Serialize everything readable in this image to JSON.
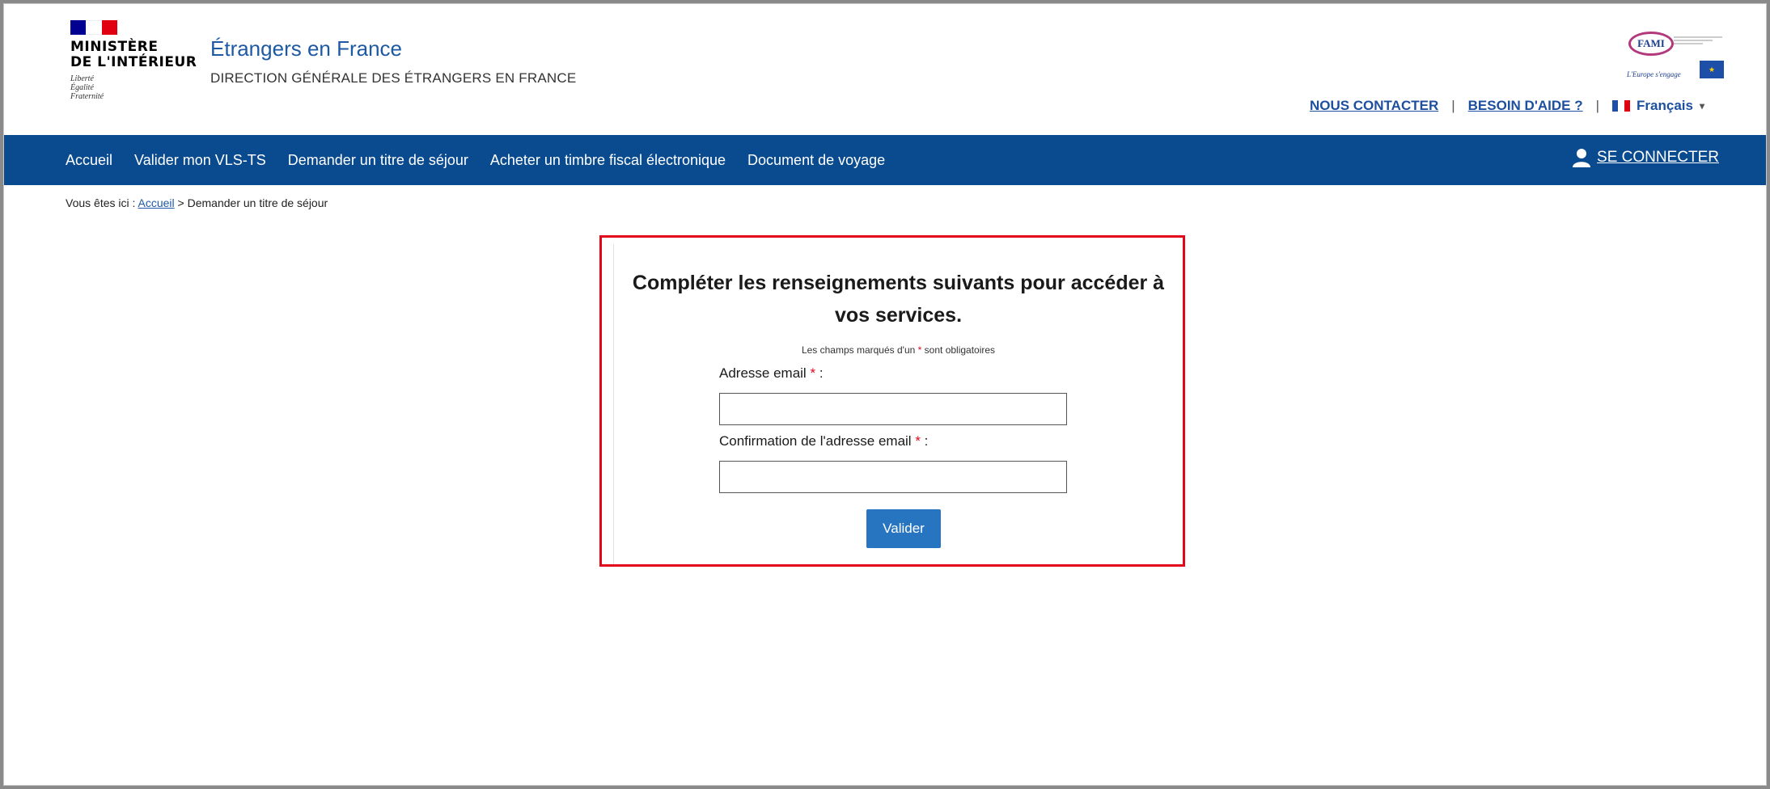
{
  "header": {
    "flag_colors": [
      "#000091",
      "#ffffff",
      "#e1000f"
    ],
    "ministry_line1": "MINISTÈRE",
    "ministry_line2": "DE L'INTÉRIEUR",
    "motto": [
      "Liberté",
      "Égalité",
      "Fraternité"
    ],
    "site_title": "Étrangers en France",
    "site_subtitle": "DIRECTION GÉNÉRALE DES ÉTRANGERS EN FRANCE",
    "fami_logo": "FAMI",
    "fami_tagline": "L'Europe s'engage",
    "links": {
      "contact": "NOUS CONTACTER",
      "help": "BESOIN D'AIDE ?",
      "language": "Français"
    }
  },
  "nav": {
    "items": [
      "Accueil",
      "Valider mon VLS-TS",
      "Demander un titre de séjour",
      "Acheter un timbre fiscal électronique",
      "Document de voyage"
    ],
    "login": "SE CONNECTER",
    "login_icon": "user-icon"
  },
  "breadcrumb": {
    "prefix": "Vous êtes ici :",
    "home": "Accueil",
    "separator": ">",
    "current": "Demander un titre de séjour"
  },
  "form": {
    "title_line1": "Compléter les renseignements suivants pour accéder à",
    "title_line2": "vos services.",
    "required_prefix": "Les champs marqués d'un",
    "required_star": "*",
    "required_suffix": "sont obligatoires",
    "email_label": "Adresse email",
    "email_value": "",
    "confirm_label": "Confirmation de l'adresse email",
    "confirm_value": "",
    "label_suffix": ":",
    "submit": "Valider"
  },
  "colors": {
    "nav_bg": "#0a4b8f",
    "link": "#1d4f9f",
    "highlight_border": "#e3061b",
    "button": "#2775c0"
  }
}
